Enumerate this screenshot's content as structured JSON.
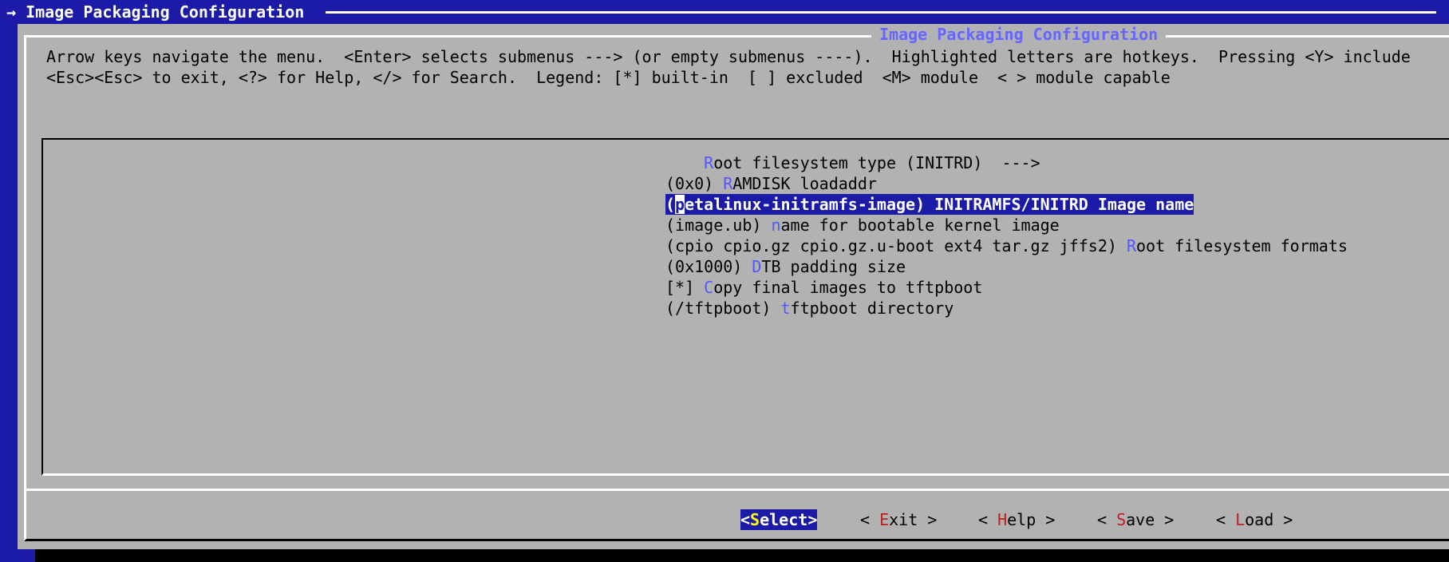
{
  "window": {
    "title": "→ Image Packaging Configuration"
  },
  "dialog": {
    "title": "Image Packaging Configuration",
    "help_line_1": "Arrow keys navigate the menu.  <Enter> selects submenus ---> (or empty submenus ----).  Highlighted letters are hotkeys.  Pressing <Y> include",
    "help_line_2": "<Esc><Esc> to exit, <?> for Help, </> for Search.  Legend: [*] built-in  [ ] excluded  <M> module  < > module capable"
  },
  "menu": {
    "items": [
      {
        "prefix": "    ",
        "hotkey": "R",
        "rest": "oot filesystem type (INITRD)  --->"
      },
      {
        "prefix": "(0x0) ",
        "hotkey": "R",
        "rest": "AMDISK loadaddr"
      },
      {
        "prefix_open": "(",
        "cursor": "p",
        "prefix_tail": "etalinux-initramfs-image) ",
        "hotkey": "I",
        "rest": "NITRAMFS/INITRD Image name",
        "selected": true
      },
      {
        "prefix": "(image.ub) ",
        "hotkey": "n",
        "rest": "ame for bootable kernel image"
      },
      {
        "prefix": "(cpio cpio.gz cpio.gz.u-boot ext4 tar.gz jffs2) ",
        "hotkey": "R",
        "rest": "oot filesystem formats"
      },
      {
        "prefix": "(0x1000) ",
        "hotkey": "D",
        "rest": "TB padding size"
      },
      {
        "prefix": "[*] ",
        "hotkey": "C",
        "rest": "opy final images to tftpboot"
      },
      {
        "prefix": "(/tftpboot) ",
        "hotkey": "t",
        "rest": "ftpboot directory"
      }
    ]
  },
  "buttons": {
    "select": {
      "open": "<",
      "hotkey": "S",
      "rest": "elect",
      "close": ">"
    },
    "exit": {
      "open": "< ",
      "hotkey": "E",
      "rest": "xit",
      "close": " >"
    },
    "help": {
      "open": "< ",
      "hotkey": "H",
      "rest": "elp",
      "close": " >"
    },
    "save": {
      "open": "< ",
      "hotkey": "S",
      "rest": "ave",
      "close": " >"
    },
    "load": {
      "open": "< ",
      "hotkey": "L",
      "rest": "oad",
      "close": " >"
    }
  },
  "colors": {
    "terminal_blue": "#1b1ba8",
    "dialog_gray": "#b2b2b2",
    "hotkey_blue": "#5555ff",
    "title_blue": "#6666ff",
    "button_hotkey_red": "#c02020"
  }
}
